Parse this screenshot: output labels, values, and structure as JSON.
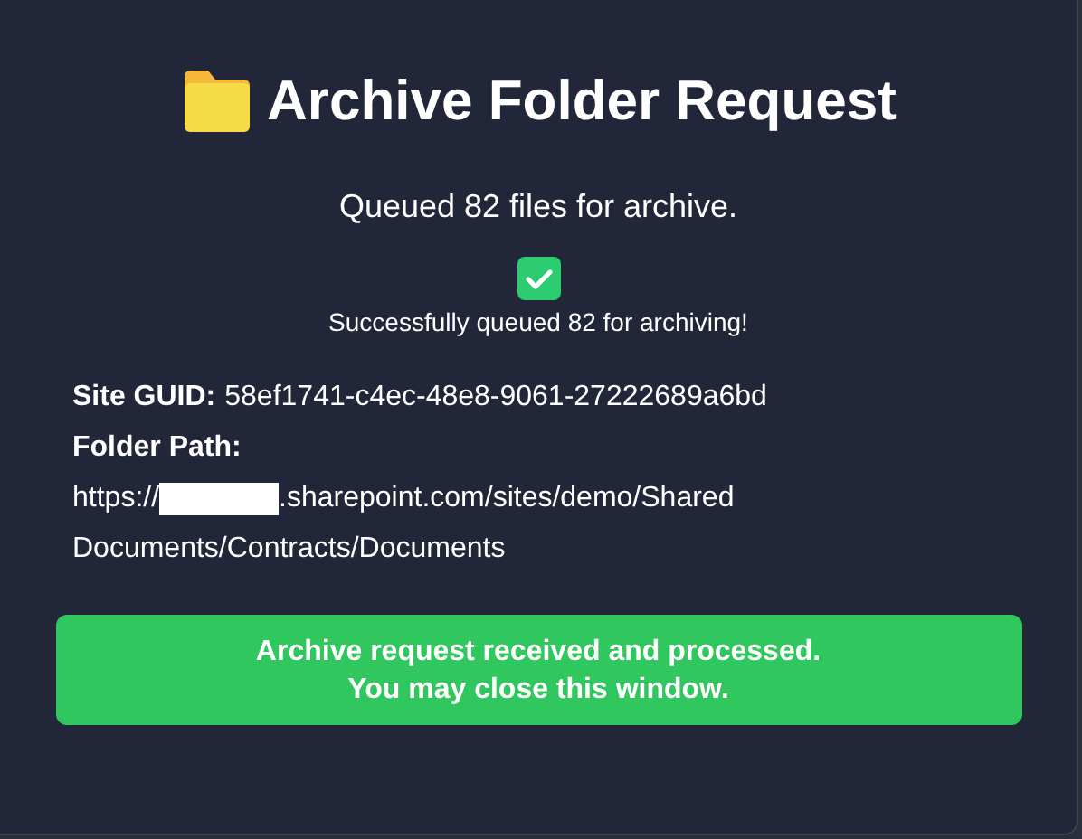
{
  "title": "Archive Folder Request",
  "message": "Queued 82 files for archive.",
  "status": {
    "success": true,
    "text": "Successfully queued 82 for archiving!"
  },
  "details": [
    {
      "label": "Site GUID:",
      "value": "58ef1741-c4ec-48e8-9061-27222689a6bd"
    }
  ],
  "folder_path": {
    "label": "Folder Path:",
    "scheme": "https://",
    "redacted": true,
    "lines": [
      ".sharepoint.com/sites/demo/Shared",
      "Documents/Contracts/Documents"
    ]
  },
  "banner": [
    "Archive request received and processed.",
    "You may close this window."
  ]
}
